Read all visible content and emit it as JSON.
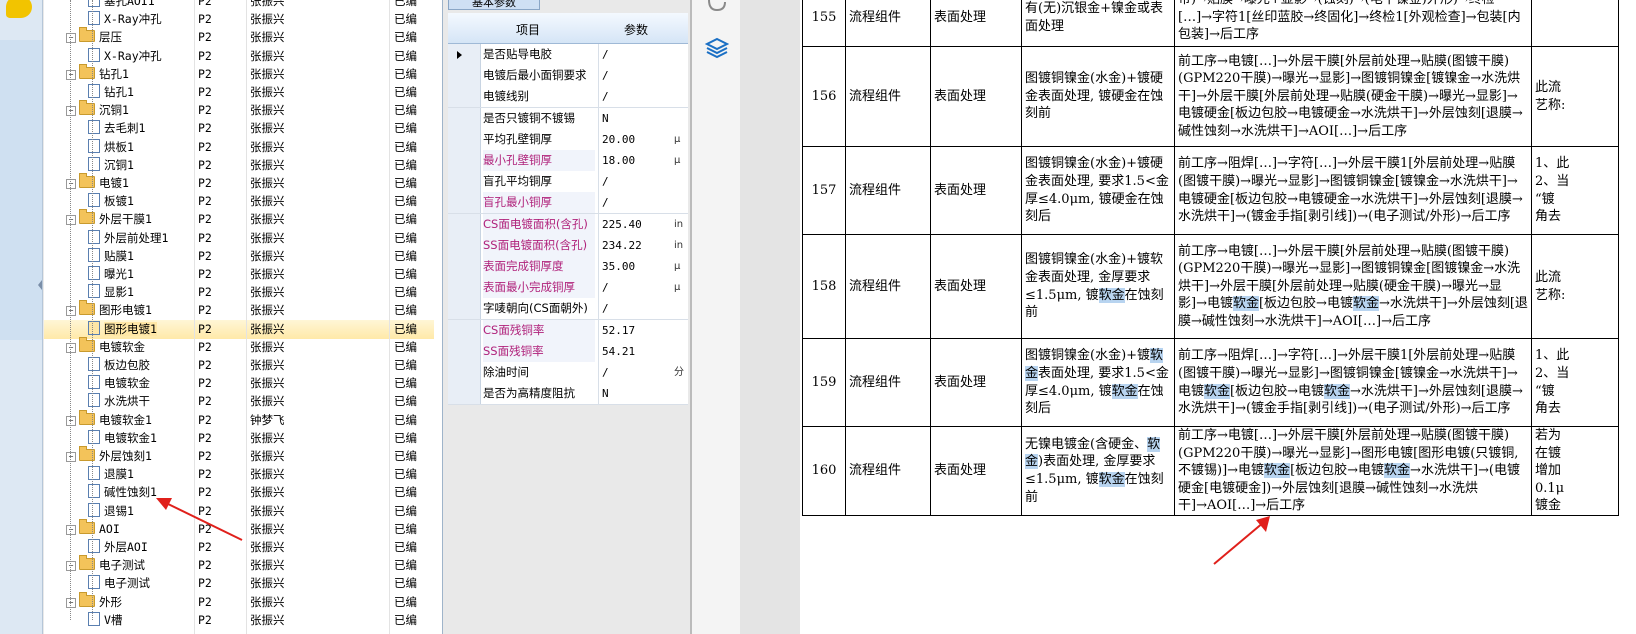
{
  "tree": {
    "rows": [
      {
        "level": 2,
        "kind": "file",
        "name": "塞孔AOI1",
        "p": "P2",
        "person": "张振兴",
        "status": "已编"
      },
      {
        "level": 2,
        "kind": "file",
        "name": "X-Ray冲孔",
        "p": "P2",
        "person": "张振兴",
        "status": "已编"
      },
      {
        "level": 1,
        "kind": "folder",
        "name": "层压",
        "p": "P2",
        "person": "张振兴",
        "status": "已编"
      },
      {
        "level": 2,
        "kind": "file",
        "name": "X-Ray冲孔",
        "p": "P2",
        "person": "张振兴",
        "status": "已编"
      },
      {
        "level": 1,
        "kind": "folder",
        "name": "钻孔1",
        "p": "P2",
        "person": "张振兴",
        "status": "已编"
      },
      {
        "level": 2,
        "kind": "file",
        "name": "钻孔1",
        "p": "P2",
        "person": "张振兴",
        "status": "已编"
      },
      {
        "level": 1,
        "kind": "folder",
        "name": "沉铜1",
        "p": "P2",
        "person": "张振兴",
        "status": "已编"
      },
      {
        "level": 2,
        "kind": "file",
        "name": "去毛刺1",
        "p": "P2",
        "person": "张振兴",
        "status": "已编"
      },
      {
        "level": 2,
        "kind": "file",
        "name": "烘板1",
        "p": "P2",
        "person": "张振兴",
        "status": "已编"
      },
      {
        "level": 2,
        "kind": "file",
        "name": "沉铜1",
        "p": "P2",
        "person": "张振兴",
        "status": "已编"
      },
      {
        "level": 1,
        "kind": "folder",
        "name": "电镀1",
        "p": "P2",
        "person": "张振兴",
        "status": "已编"
      },
      {
        "level": 2,
        "kind": "file",
        "name": "板镀1",
        "p": "P2",
        "person": "张振兴",
        "status": "已编"
      },
      {
        "level": 1,
        "kind": "folder",
        "name": "外层干膜1",
        "p": "P2",
        "person": "张振兴",
        "status": "已编"
      },
      {
        "level": 2,
        "kind": "file",
        "name": "外层前处理1",
        "p": "P2",
        "person": "张振兴",
        "status": "已编"
      },
      {
        "level": 2,
        "kind": "file",
        "name": "贴膜1",
        "p": "P2",
        "person": "张振兴",
        "status": "已编"
      },
      {
        "level": 2,
        "kind": "file",
        "name": "曝光1",
        "p": "P2",
        "person": "张振兴",
        "status": "已编"
      },
      {
        "level": 2,
        "kind": "file",
        "name": "显影1",
        "p": "P2",
        "person": "张振兴",
        "status": "已编"
      },
      {
        "level": 1,
        "kind": "folder",
        "name": "图形电镀1",
        "p": "P2",
        "person": "张振兴",
        "status": "已编"
      },
      {
        "level": 2,
        "kind": "file",
        "name": "图形电镀1",
        "p": "P2",
        "person": "张振兴",
        "status": "已编",
        "selected": true
      },
      {
        "level": 1,
        "kind": "folder",
        "name": "电镀软金",
        "p": "P2",
        "person": "张振兴",
        "status": "已编"
      },
      {
        "level": 2,
        "kind": "file",
        "name": "板边包胶",
        "p": "P2",
        "person": "张振兴",
        "status": "已编"
      },
      {
        "level": 2,
        "kind": "file",
        "name": "电镀软金",
        "p": "P2",
        "person": "张振兴",
        "status": "已编"
      },
      {
        "level": 2,
        "kind": "file",
        "name": "水洗烘干",
        "p": "P2",
        "person": "张振兴",
        "status": "已编"
      },
      {
        "level": 1,
        "kind": "folder",
        "name": "电镀软金1",
        "p": "P2",
        "person": "钟梦飞",
        "status": "已编"
      },
      {
        "level": 2,
        "kind": "file",
        "name": "电镀软金1",
        "p": "P2",
        "person": "张振兴",
        "status": "已编"
      },
      {
        "level": 1,
        "kind": "folder",
        "name": "外层蚀刻1",
        "p": "P2",
        "person": "张振兴",
        "status": "已编"
      },
      {
        "level": 2,
        "kind": "file",
        "name": "退膜1",
        "p": "P2",
        "person": "张振兴",
        "status": "已编"
      },
      {
        "level": 2,
        "kind": "file",
        "name": "碱性蚀刻1",
        "p": "P2",
        "person": "张振兴",
        "status": "已编"
      },
      {
        "level": 2,
        "kind": "file",
        "name": "退锡1",
        "p": "P2",
        "person": "张振兴",
        "status": "已编"
      },
      {
        "level": 1,
        "kind": "folder",
        "name": "AOI",
        "p": "P2",
        "person": "张振兴",
        "status": "已编"
      },
      {
        "level": 2,
        "kind": "file",
        "name": "外层AOI",
        "p": "P2",
        "person": "张振兴",
        "status": "已编"
      },
      {
        "level": 1,
        "kind": "folder",
        "name": "电子测试",
        "p": "P2",
        "person": "张振兴",
        "status": "已编"
      },
      {
        "level": 2,
        "kind": "file",
        "name": "电子测试",
        "p": "P2",
        "person": "张振兴",
        "status": "已编"
      },
      {
        "level": 1,
        "kind": "folder",
        "name": "外形",
        "p": "P2",
        "person": "张振兴",
        "status": "已编"
      },
      {
        "level": 2,
        "kind": "file",
        "name": "V槽",
        "p": "P2",
        "person": "张振兴",
        "status": "已编"
      }
    ]
  },
  "props": {
    "tab_label": "基本参数",
    "header_item": "项目",
    "header_value": "参数",
    "rows": [
      {
        "name": "是否贴导电胶",
        "value": "/",
        "unit": "",
        "hl": false
      },
      {
        "name": "电镀后最小面铜要求",
        "value": "/",
        "unit": "",
        "hl": false
      },
      {
        "name": "电镀线别",
        "value": "/",
        "unit": "",
        "hl": false
      },
      {
        "name": "是否只镀铜不镀锡",
        "value": "N",
        "unit": "",
        "hl": false
      },
      {
        "name": "平均孔壁铜厚",
        "value": "20.00",
        "unit": "μ",
        "hl": false
      },
      {
        "name": "最小孔壁铜厚",
        "value": "18.00",
        "unit": "μ",
        "hl": true
      },
      {
        "name": "盲孔平均铜厚",
        "value": "/",
        "unit": "",
        "hl": false
      },
      {
        "name": "盲孔最小铜厚",
        "value": "/",
        "unit": "",
        "hl": true
      },
      {
        "name": "CS面电镀面积(含孔)",
        "value": "225.40",
        "unit": "in",
        "hl": true
      },
      {
        "name": "SS面电镀面积(含孔)",
        "value": "234.22",
        "unit": "in",
        "hl": true
      },
      {
        "name": "表面完成铜厚度",
        "value": "35.00",
        "unit": "μ",
        "hl": true
      },
      {
        "name": "表面最小完成铜厚",
        "value": "/",
        "unit": "μ",
        "hl": true
      },
      {
        "name": "字唛朝向(CS面朝外)",
        "value": "/",
        "unit": "",
        "hl": false
      },
      {
        "name": "CS面残铜率",
        "value": "52.17",
        "unit": "",
        "hl": true
      },
      {
        "name": "SS面残铜率",
        "value": "54.21",
        "unit": "",
        "hl": true
      },
      {
        "name": "除油时间",
        "value": "/",
        "unit": "分",
        "hl": false
      },
      {
        "name": "是否为高精度阻抗",
        "value": "N",
        "unit": "",
        "hl": false
      }
    ]
  },
  "doc": {
    "rows": [
      {
        "no": "155",
        "type": "流程组件",
        "cat": "表面处理",
        "desc": [
          {
            "t": "有(无)沉银金+镍金或表"
          },
          {
            "t": "面处理"
          }
        ],
        "process": [
          {
            "t": "带)→贴膜→曝光+显影→(蚀刻)→(电干镍金)外"
          },
          {
            "t": "形)→终检[…]→字符1[丝印蓝胶→终固化]→终检1[外"
          },
          {
            "t": "观检查]→包装[内包装]→后工序"
          }
        ],
        "extra": []
      },
      {
        "no": "156",
        "type": "流程组件",
        "cat": "表面处理",
        "desc": [
          {
            "t": "图镀铜镍金(水金)+镀硬金表面处理, 镀硬金在蚀刻前"
          }
        ],
        "process": [
          {
            "t": "前工序→电镀[…]→外层干膜[外层前处理→贴膜(图镀干膜)(GPM220干膜)→曝光→显影]→图镀铜镍金[镀镍金→水洗烘干]→外层干膜[外层前处理→贴膜(硬金干膜)→曝光→显影]→电镀硬金[板边包胶→电镀硬金→水洗烘干]→外层蚀刻[退膜→碱性蚀刻→水洗烘干]→AOI[…]→后工序"
          }
        ],
        "extra": [
          {
            "t": "此流"
          },
          {
            "t": "艺称:"
          }
        ]
      },
      {
        "no": "157",
        "type": "流程组件",
        "cat": "表面处理",
        "desc": [
          {
            "t": "图镀铜镍金(水金)+镀硬金表面处理, 要求1.5<金厚≤4.0μm, 镀硬金在蚀刻后"
          }
        ],
        "process": [
          {
            "t": "前工序→阻焊[…]→字符[…]→外层干膜1[外层前处理→贴膜(图镀干膜)→曝光→显影]→图镀铜镍金[镀镍金→水洗烘干]→电镀硬金[板边包胶→电镀硬金→水洗烘干]→外层蚀刻[退膜→水洗烘干]→(镀金手指[剥引线])→(电子测试/外形)→后工序"
          }
        ],
        "extra": [
          {
            "t": "1、此"
          },
          {
            "t": "2、当"
          },
          {
            "t": "“镀"
          },
          {
            "t": "角去"
          }
        ]
      },
      {
        "no": "158",
        "type": "流程组件",
        "cat": "表面处理",
        "desc": [
          {
            "t": "图镀铜镍金(水金)+镀软金表面处理, 金厚要求≤1.5μm, 镀"
          },
          {
            "t": "软金",
            "hl": true
          },
          {
            "t": "在蚀刻前"
          }
        ],
        "process": [
          {
            "t": "前工序→电镀[…]→外层干膜[外层前处理→贴膜(图镀干膜)(GPM220干膜)→曝光→显影]→图镀铜镍金[图镀镍金→水洗烘干]→外层干膜[外层前处理→贴膜(硬金干膜)→曝光→显影]→电镀"
          },
          {
            "t": "软金",
            "hl": true
          },
          {
            "t": "[板边包胶→电镀"
          },
          {
            "t": "软金",
            "hl": true
          },
          {
            "t": "→水洗烘干]→外层蚀刻[退膜→碱性蚀刻→水洗烘干]→AOI[…]→后工序"
          }
        ],
        "extra": [
          {
            "t": "此流"
          },
          {
            "t": "艺称:"
          }
        ]
      },
      {
        "no": "159",
        "type": "流程组件",
        "cat": "表面处理",
        "desc": [
          {
            "t": "图镀铜镍金(水金)+镀"
          },
          {
            "t": "软金",
            "hl": true
          },
          {
            "t": "表面处理, 要求1.5<金厚≤4.0μm, 镀"
          },
          {
            "t": "软金",
            "hl": true
          },
          {
            "t": "在蚀刻后"
          }
        ],
        "process": [
          {
            "t": "前工序→阻焊[…]→字符[…]→外层干膜1[外层前处理→贴膜(图镀干膜)→曝光→显影]→图镀铜镍金[镀镍金→水洗烘干]→电镀"
          },
          {
            "t": "软金",
            "hl": true
          },
          {
            "t": "[板边包胶→电镀"
          },
          {
            "t": "软金",
            "hl": true
          },
          {
            "t": "→水洗烘干]→外层蚀刻[退膜→水洗烘干]→(镀金手指[剥引线])→(电子测试/外形)→后工序"
          }
        ],
        "extra": [
          {
            "t": "1、此"
          },
          {
            "t": "2、当"
          },
          {
            "t": "“镀"
          },
          {
            "t": "角去"
          }
        ]
      },
      {
        "no": "160",
        "type": "流程组件",
        "cat": "表面处理",
        "desc": [
          {
            "t": "无镍电镀金(含硬金、"
          },
          {
            "t": "软金",
            "hl": true
          },
          {
            "t": ")表面处理, 金厚要求≤1.5μm, 镀"
          },
          {
            "t": "软金",
            "hl": true
          },
          {
            "t": "在蚀刻前"
          }
        ],
        "process": [
          {
            "t": "前工序→电镀[…]→外层干膜[外层前处理→贴膜(图镀干膜)(GPM220干膜)→曝光→显影]→图形电镀[图形电镀(只镀铜, 不镀锡)]→电镀"
          },
          {
            "t": "软金",
            "hl": true
          },
          {
            "t": "[板边包胶→电镀"
          },
          {
            "t": "软金",
            "hl": true
          },
          {
            "t": "→水洗烘干]→(电镀硬金[电镀硬金])→外层蚀刻[退膜→碱性蚀刻→水洗烘干]→AOI[…]→后工序"
          }
        ],
        "extra": [
          {
            "t": "若为"
          },
          {
            "t": "在镀"
          },
          {
            "t": "增加"
          },
          {
            "t": "0.1μ"
          },
          {
            "t": "镀金"
          }
        ]
      }
    ]
  },
  "colors": {
    "accent": "#1a6fc4",
    "highlight": "#b8d4f0",
    "annotation": "#e0201b",
    "prop_magenta": "#b0227b"
  }
}
